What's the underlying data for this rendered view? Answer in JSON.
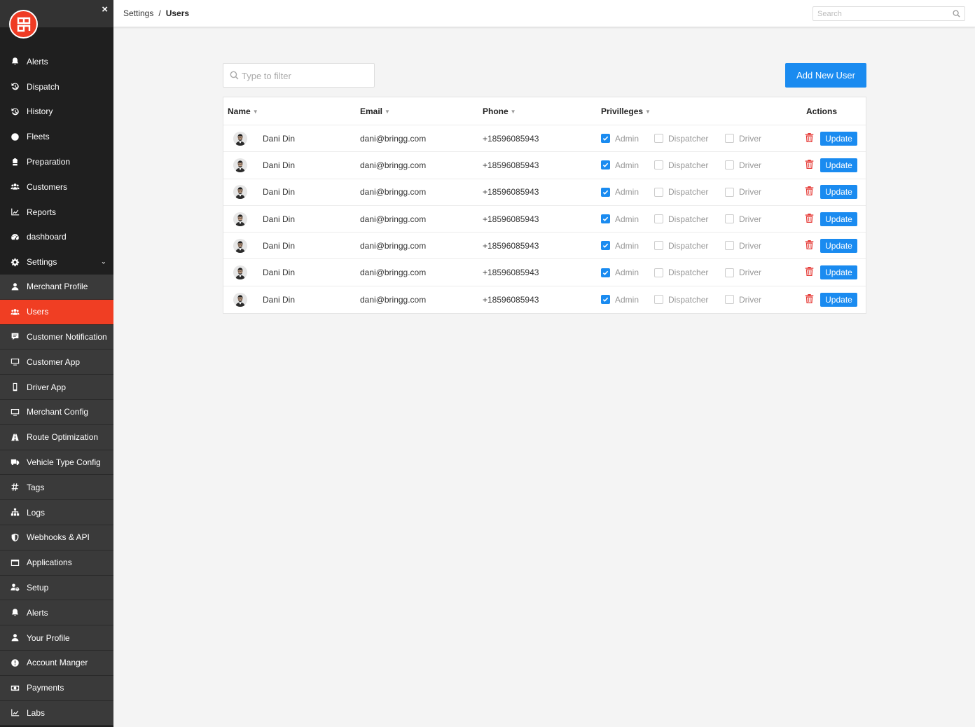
{
  "sidebar": {
    "close": "×",
    "main_items": [
      {
        "label": "Alerts",
        "icon": "bell-icon"
      },
      {
        "label": "Dispatch",
        "icon": "history-arrow-icon"
      },
      {
        "label": "History",
        "icon": "history-arrow-icon"
      },
      {
        "label": "Fleets",
        "icon": "globe-icon"
      },
      {
        "label": "Preparation",
        "icon": "chef-hat-icon"
      },
      {
        "label": "Customers",
        "icon": "users-icon"
      },
      {
        "label": "Reports",
        "icon": "line-chart-icon"
      },
      {
        "label": "dashboard",
        "icon": "gauge-icon"
      },
      {
        "label": "Settings",
        "icon": "gear-icon",
        "chevron": "⌄"
      }
    ],
    "sub_items": [
      {
        "label": "Merchant Profile",
        "icon": "user-icon"
      },
      {
        "label": "Users",
        "icon": "users-icon",
        "active": true
      },
      {
        "label": "Customer Notification",
        "icon": "comment-icon"
      },
      {
        "label": "Customer App",
        "icon": "monitor-icon"
      },
      {
        "label": "Driver App",
        "icon": "mobile-icon"
      },
      {
        "label": "Merchant Config",
        "icon": "monitor-icon"
      },
      {
        "label": "Route Optimization",
        "icon": "road-icon"
      },
      {
        "label": "Vehicle Type Config",
        "icon": "truck-icon"
      },
      {
        "label": "Tags",
        "icon": "hashtag-icon"
      },
      {
        "label": "Logs",
        "icon": "sitemap-icon"
      },
      {
        "label": "Webhooks & API",
        "icon": "shield-icon"
      },
      {
        "label": "Applications",
        "icon": "window-icon"
      },
      {
        "label": "Setup",
        "icon": "user-gear-icon"
      },
      {
        "label": "Alerts",
        "icon": "bell-icon"
      },
      {
        "label": "Your Profile",
        "icon": "user-icon"
      },
      {
        "label": "Account Manger",
        "icon": "exclamation-icon"
      },
      {
        "label": "Payments",
        "icon": "money-icon"
      },
      {
        "label": "Labs",
        "icon": "line-chart-icon"
      }
    ]
  },
  "topbar": {
    "breadcrumb": [
      "Settings",
      "Users"
    ],
    "breadcrumb_sep": "/",
    "search_placeholder": "Search"
  },
  "main": {
    "filter_placeholder": "Type to filter",
    "add_button": "Add New User",
    "table": {
      "columns": [
        "Name",
        "Email",
        "Phone",
        "Privilleges",
        "Actions"
      ],
      "sort_caret": "▼",
      "privilege_labels": [
        "Admin",
        "Dispatcher",
        "Driver"
      ],
      "update_label": "Update",
      "rows": [
        {
          "name": "Dani Din",
          "email": "dani@bringg.com",
          "phone": "+18596085943",
          "admin": true,
          "dispatcher": false,
          "driver": false
        },
        {
          "name": "Dani Din",
          "email": "dani@bringg.com",
          "phone": "+18596085943",
          "admin": true,
          "dispatcher": false,
          "driver": false
        },
        {
          "name": "Dani Din",
          "email": "dani@bringg.com",
          "phone": "+18596085943",
          "admin": true,
          "dispatcher": false,
          "driver": false
        },
        {
          "name": "Dani Din",
          "email": "dani@bringg.com",
          "phone": "+18596085943",
          "admin": true,
          "dispatcher": false,
          "driver": false
        },
        {
          "name": "Dani Din",
          "email": "dani@bringg.com",
          "phone": "+18596085943",
          "admin": true,
          "dispatcher": false,
          "driver": false
        },
        {
          "name": "Dani Din",
          "email": "dani@bringg.com",
          "phone": "+18596085943",
          "admin": true,
          "dispatcher": false,
          "driver": false
        },
        {
          "name": "Dani Din",
          "email": "dani@bringg.com",
          "phone": "+18596085943",
          "admin": true,
          "dispatcher": false,
          "driver": false
        }
      ]
    }
  },
  "colors": {
    "accent": "#1a8bf0",
    "brand": "#ef3b24",
    "sidebar_bg": "#1f1f1f",
    "active_item": "#f03e23",
    "delete": "#e53935"
  }
}
